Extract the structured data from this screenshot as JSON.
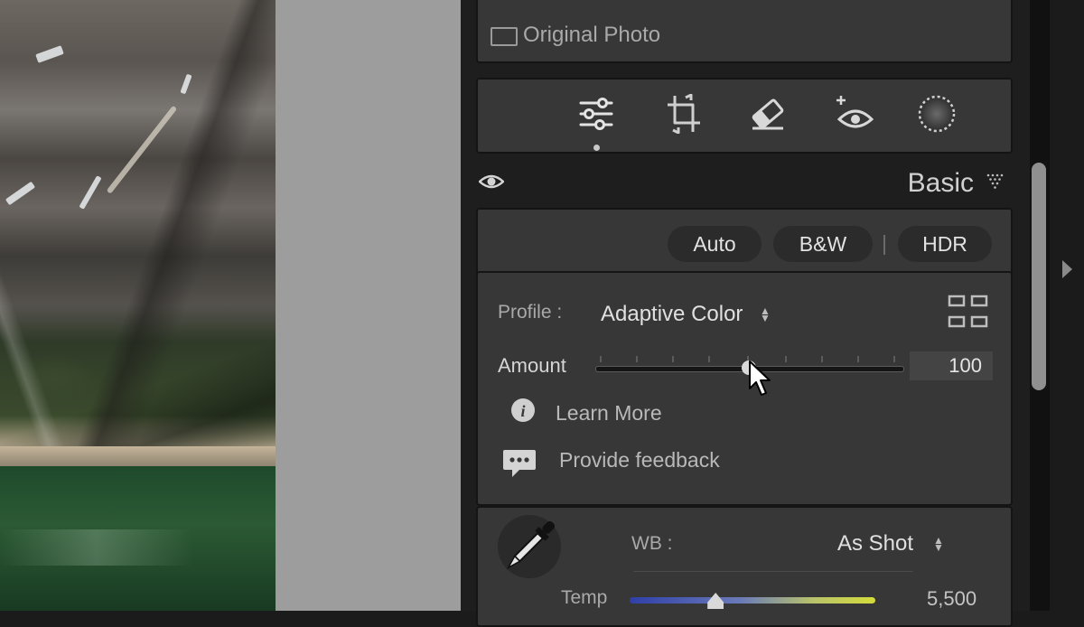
{
  "original_photo": {
    "label": "Original Photo"
  },
  "tools": [
    {
      "name": "edit-sliders-icon"
    },
    {
      "name": "crop-icon"
    },
    {
      "name": "healing-eraser-icon"
    },
    {
      "name": "redeye-icon"
    },
    {
      "name": "masking-icon"
    }
  ],
  "basic": {
    "title": "Basic",
    "buttons": {
      "auto": "Auto",
      "bw": "B&W",
      "hdr": "HDR"
    },
    "profile": {
      "label": "Profile :",
      "value": "Adaptive Color"
    },
    "amount": {
      "label": "Amount",
      "value": "100",
      "level": 0.5
    },
    "learn_more": "Learn More",
    "feedback": "Provide feedback",
    "wb": {
      "label": "WB :",
      "value": "As Shot"
    },
    "temp": {
      "label": "Temp",
      "value": "5,500",
      "level": 0.35
    }
  },
  "colors": {
    "panel_bg": "#373737",
    "workspace_gray": "#9d9d9d",
    "temp_blue": "#2f3fa8",
    "temp_yellow": "#d4dc3a"
  }
}
